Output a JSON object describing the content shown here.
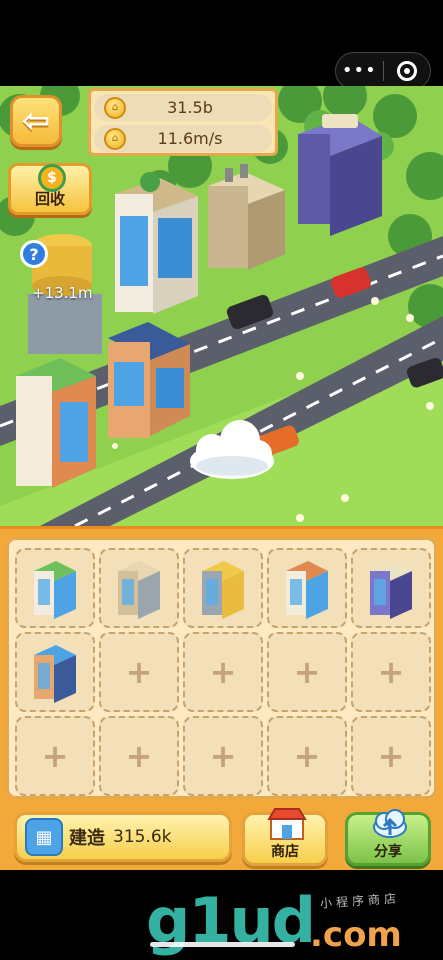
{
  "capsule": {
    "more_icon": "more-dots-icon",
    "close_icon": "target-ring-icon"
  },
  "hud": {
    "coins_total": "31.5b",
    "coin_rate": "11.6m/s",
    "coin_icon": "coin-icon",
    "back_icon": "back-arrow-icon"
  },
  "recycle": {
    "label": "回收",
    "icon": "dollar-recycle-icon"
  },
  "help": {
    "glyph": "?"
  },
  "floating_income": "+13.1m",
  "slots": {
    "rows": 3,
    "cols": 5,
    "filled": [
      "green-roof-tower",
      "beige-building",
      "water-tank-tower",
      "ivy-tower",
      "purple-building",
      "solar-house"
    ],
    "empty_glyph": "+"
  },
  "build": {
    "label": "建造",
    "cost": "315.6k",
    "icon": "building-icon"
  },
  "shop": {
    "label": "商店",
    "icon": "storefront-icon"
  },
  "share": {
    "label": "分享",
    "icon": "cloud-upload-icon"
  },
  "watermark": {
    "logo": "g1ud",
    "domain": ".com",
    "tagline": "小程序商店"
  },
  "colors": {
    "grass": "#8fd14e",
    "road": "#5b5f6b",
    "panel": "#f3a93a",
    "slot_bg": "#f3dfb8"
  }
}
